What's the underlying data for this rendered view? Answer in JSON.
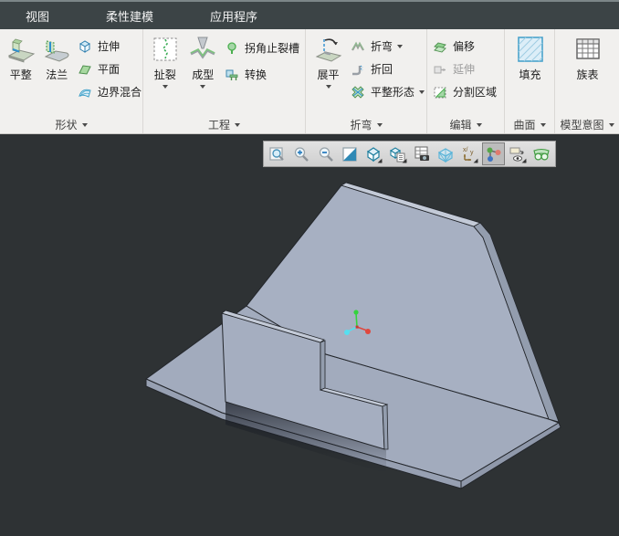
{
  "tab_bar": {
    "tabs": [
      {
        "label": "视图"
      },
      {
        "label": "柔性建模"
      },
      {
        "label": "应用程序"
      }
    ]
  },
  "ribbon": {
    "groups": [
      {
        "label": "形状",
        "items": [
          {
            "label": "平整",
            "icon": "flat-icon",
            "size": "large",
            "dropdown": false
          },
          {
            "label": "法兰",
            "icon": "flange-icon",
            "size": "large",
            "dropdown": false
          },
          {
            "label": "拉伸",
            "icon": "extrude-icon",
            "size": "small"
          },
          {
            "label": "平面",
            "icon": "planar-icon",
            "size": "small"
          },
          {
            "label": "边界混合",
            "icon": "boundary-blend-icon",
            "size": "small"
          }
        ]
      },
      {
        "label": "工程",
        "items": [
          {
            "label": "扯裂",
            "icon": "rip-icon",
            "size": "large",
            "dropdown": true
          },
          {
            "label": "成型",
            "icon": "form-icon",
            "size": "large",
            "dropdown": true
          },
          {
            "label": "拐角止裂槽",
            "icon": "corner-relief-icon",
            "size": "small"
          },
          {
            "label": "转换",
            "icon": "convert-icon",
            "size": "small"
          }
        ]
      },
      {
        "label": "折弯",
        "items": [
          {
            "label": "展平",
            "icon": "flatten-icon",
            "size": "large",
            "dropdown": true
          },
          {
            "label": "折弯",
            "icon": "bend-icon",
            "size": "small",
            "dropdown": true
          },
          {
            "label": "折回",
            "icon": "bend-back-icon",
            "size": "small"
          },
          {
            "label": "平整形态",
            "icon": "flat-pattern-icon",
            "size": "small",
            "dropdown": true
          }
        ]
      },
      {
        "label": "编辑",
        "items": [
          {
            "label": "偏移",
            "icon": "offset-icon",
            "size": "small"
          },
          {
            "label": "延伸",
            "icon": "extend-icon",
            "size": "small",
            "disabled": true
          },
          {
            "label": "分割区域",
            "icon": "split-area-icon",
            "size": "small"
          }
        ]
      },
      {
        "label": "曲面",
        "items": [
          {
            "label": "填充",
            "icon": "fill-icon",
            "size": "large"
          }
        ]
      },
      {
        "label": "模型意图",
        "items": [
          {
            "label": "族表",
            "icon": "family-table-icon",
            "size": "large"
          }
        ]
      }
    ]
  },
  "graphics_toolbar": {
    "buttons": [
      {
        "icon": "refit-icon",
        "selected": false
      },
      {
        "icon": "zoom-in-icon",
        "selected": false
      },
      {
        "icon": "zoom-out-icon",
        "selected": false
      },
      {
        "icon": "repaint-icon",
        "selected": false
      },
      {
        "icon": "display-style-icon",
        "selected": false,
        "dropdown": true
      },
      {
        "icon": "saved-orientations-icon",
        "selected": false,
        "dropdown": true
      },
      {
        "icon": "view-manager-icon",
        "selected": false
      },
      {
        "icon": "perspective-icon",
        "selected": false
      },
      {
        "icon": "datum-display-icon",
        "selected": false,
        "dropdown": true
      },
      {
        "icon": "annotation-display-icon",
        "selected": true
      },
      {
        "icon": "visibility-icon",
        "selected": false,
        "dropdown": true
      },
      {
        "icon": "stereo-glasses-icon",
        "selected": false
      }
    ]
  },
  "viewport": {
    "part": "sheet-metal-part",
    "background_color": "#2e3234",
    "part_face_color": "#a7b0c2",
    "triad_colors": {
      "x": "#e0483e",
      "y": "#35d33e",
      "z": "#55dff0"
    }
  }
}
